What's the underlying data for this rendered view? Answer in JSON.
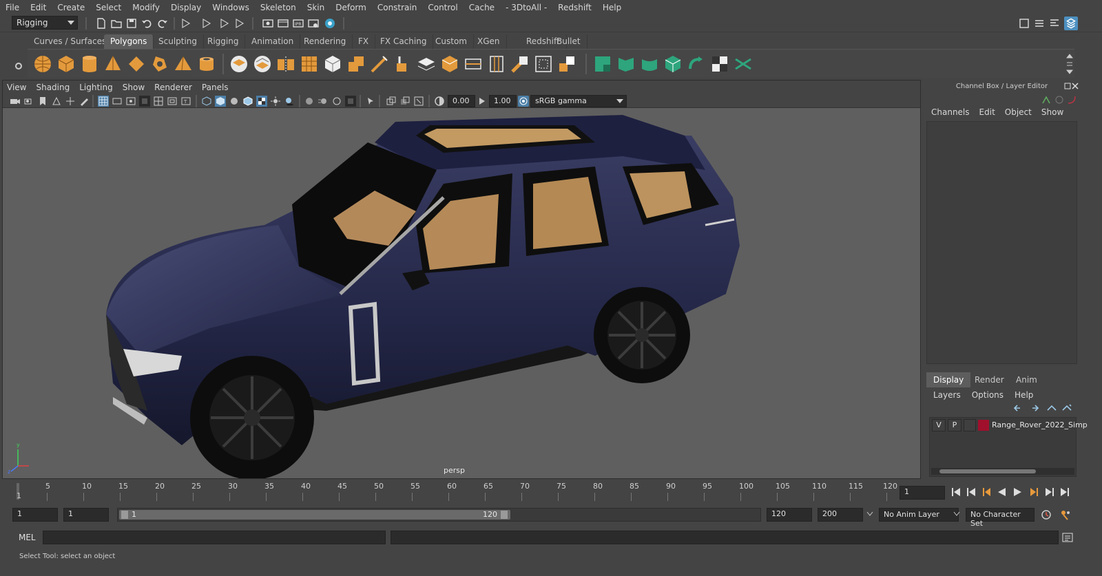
{
  "menubar": {
    "items": [
      "File",
      "Edit",
      "Create",
      "Select",
      "Modify",
      "Display",
      "Windows",
      "Skeleton",
      "Skin",
      "Deform",
      "Constrain",
      "Control",
      "Cache",
      "- 3DtoAll -",
      "Redshift",
      "Help"
    ]
  },
  "statusline": {
    "menuset": "Rigging"
  },
  "shelf": {
    "tabs": [
      "Curves / Surfaces",
      "Polygons",
      "Sculpting",
      "Rigging",
      "Animation",
      "Rendering",
      "FX",
      "FX Caching",
      "Custom",
      "XGen",
      "Redshift",
      "Bullet"
    ],
    "active_tab": "Polygons"
  },
  "viewport": {
    "menu": [
      "View",
      "Shading",
      "Lighting",
      "Show",
      "Renderer",
      "Panels"
    ],
    "exposure": "0.00",
    "gamma": "1.00",
    "colorspace": "sRGB gamma",
    "camera": "persp",
    "vehicle_color": "#1d1f3d"
  },
  "channelbox": {
    "title": "Channel Box / Layer Editor",
    "menu": [
      "Channels",
      "Edit",
      "Object",
      "Show"
    ]
  },
  "layereditor": {
    "tabs": [
      "Display",
      "Render",
      "Anim"
    ],
    "active_tab": "Display",
    "menu": [
      "Layers",
      "Options",
      "Help"
    ],
    "layer": {
      "v": "V",
      "p": "P",
      "name": "Range_Rover_2022_Simp",
      "color": "#a0102c"
    }
  },
  "timeline": {
    "ticks": [
      "5",
      "10",
      "15",
      "20",
      "25",
      "30",
      "35",
      "40",
      "45",
      "50",
      "55",
      "60",
      "65",
      "70",
      "75",
      "80",
      "85",
      "90",
      "95",
      "100",
      "105",
      "110",
      "115",
      "120"
    ],
    "start_marker": "1",
    "current_frame": "1"
  },
  "range": {
    "start": "1",
    "anim_start": "1",
    "slider_start": "1",
    "slider_end": "120",
    "end": "120",
    "anim_end": "200",
    "anim_layer": "No Anim Layer",
    "character_set": "No Character Set"
  },
  "commandline": {
    "language": "MEL"
  },
  "helpline": {
    "text": "Select Tool: select an object"
  }
}
